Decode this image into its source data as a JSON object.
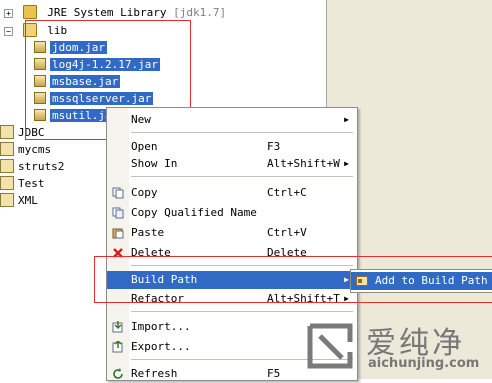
{
  "tree": {
    "jre": {
      "label": "JRE System Library",
      "version": "[jdk1.7]"
    },
    "lib": {
      "label": "lib"
    },
    "jars": [
      "jdom.jar",
      "log4j-1.2.17.jar",
      "msbase.jar",
      "mssqlserver.jar",
      "msutil.jar"
    ],
    "projects": [
      "JDBC",
      "mycms",
      "struts2",
      "Test",
      "XML"
    ]
  },
  "menu": {
    "new": "New",
    "open": "Open",
    "open_acc": "F3",
    "show_in": "Show In",
    "show_in_acc": "Alt+Shift+W",
    "copy": "Copy",
    "copy_acc": "Ctrl+C",
    "copy_qualified": "Copy Qualified Name",
    "paste": "Paste",
    "paste_acc": "Ctrl+V",
    "delete": "Delete",
    "delete_acc": "Delete",
    "build_path": "Build Path",
    "refactor": "Refactor",
    "refactor_acc": "Alt+Shift+T",
    "import": "Import...",
    "export": "Export...",
    "refresh": "Refresh",
    "refresh_acc": "F5"
  },
  "submenu": {
    "add_to_build_path": "Add to Build Path"
  },
  "watermark": {
    "title": "爱纯净",
    "url": "aichunjing.com"
  },
  "colors": {
    "selection": "#316ac5",
    "annotation": "#e03030"
  }
}
